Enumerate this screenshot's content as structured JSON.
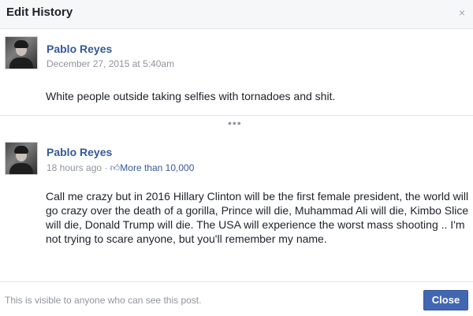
{
  "dialog": {
    "title": "Edit History",
    "close_icon": "close-icon",
    "close_glyph": "×"
  },
  "entries": [
    {
      "author": "Pablo Reyes",
      "timestamp": "December 27, 2015 at 5:40am",
      "text": "White people outside taking selfies with tornadoes and shit."
    },
    {
      "author": "Pablo Reyes",
      "timestamp": "18 hours ago",
      "separator": "·",
      "likes_icon": "thumbs-up-icon",
      "likes_label": "More than 10,000",
      "text": "Call me crazy but in 2016 Hillary Clinton will be the first female president, the world will go crazy over the death of a gorilla, Prince will die, Muhammad Ali will die, Kimbo Slice will die, Donald Trump will die. The USA will experience the worst mass shooting .. I'm not trying to scare anyone, but you'll remember my name."
    }
  ],
  "more": {
    "label": "•••",
    "icon": "more-dots-icon"
  },
  "footer": {
    "visibility_note": "This is visible to anyone who can see this post.",
    "close_label": "Close"
  },
  "colors": {
    "accent": "#4267b2",
    "link": "#365899",
    "muted": "#90949c",
    "header_bg": "#f6f7f9"
  }
}
